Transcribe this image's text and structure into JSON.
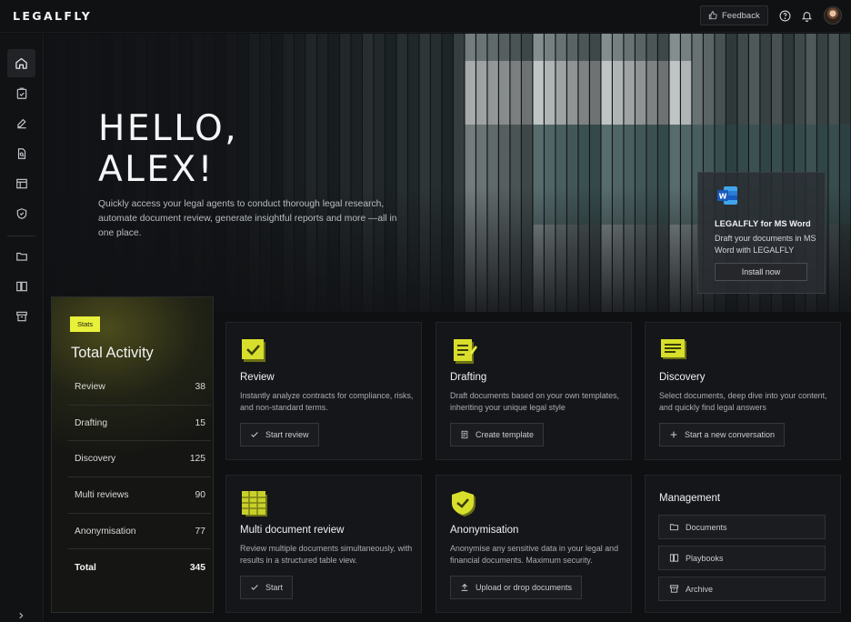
{
  "app": {
    "logo": "LEGALFLY"
  },
  "topbar": {
    "feedback_label": "Feedback"
  },
  "hero": {
    "title_line1": "HELLO,",
    "title_line2": "ALEX!",
    "subtitle": "Quickly access your legal agents to conduct thorough legal research, automate document review, generate insightful reports and more —all in one place."
  },
  "word_promo": {
    "title": "LEGALFLY for MS Word",
    "description": "Draft your documents in MS Word with LEGALFLY",
    "button": "Install now"
  },
  "stats": {
    "badge": "Stats",
    "title": "Total Activity",
    "rows": [
      {
        "label": "Review",
        "value": "38"
      },
      {
        "label": "Drafting",
        "value": "15"
      },
      {
        "label": "Discovery",
        "value": "125"
      },
      {
        "label": "Multi reviews",
        "value": "90"
      },
      {
        "label": "Anonymisation",
        "value": "77"
      }
    ],
    "total_label": "Total",
    "total_value": "345"
  },
  "cards": {
    "review": {
      "title": "Review",
      "description": "Instantly analyze contracts for compliance, risks, and non-standard terms.",
      "button": "Start review",
      "icon": "check-icon"
    },
    "drafting": {
      "title": "Drafting",
      "description": "Draft documents based on your own templates, inheriting your unique legal style",
      "button": "Create template",
      "icon": "document-icon"
    },
    "discovery": {
      "title": "Discovery",
      "description": "Select documents, deep dive into your content, and quickly find legal answers",
      "button": "Start a new conversation",
      "icon": "plus-icon"
    },
    "multi": {
      "title": "Multi document review",
      "description": "Review multiple documents simultaneously, with results in a structured table view.",
      "button": "Start",
      "icon": "check-icon"
    },
    "anon": {
      "title": "Anonymisation",
      "description": "Anonymise any sensitive data in your legal and financial documents. Maximum security.",
      "button": "Upload or drop documents",
      "icon": "upload-icon"
    }
  },
  "management": {
    "title": "Management",
    "items": [
      {
        "label": "Documents",
        "icon": "folder-icon"
      },
      {
        "label": "Playbooks",
        "icon": "book-icon"
      },
      {
        "label": "Archive",
        "icon": "archive-icon"
      }
    ]
  },
  "colors": {
    "accent": "#E8F03A",
    "background": "#0F1012",
    "card": "#15161A",
    "word_blue": "#185ABD"
  }
}
